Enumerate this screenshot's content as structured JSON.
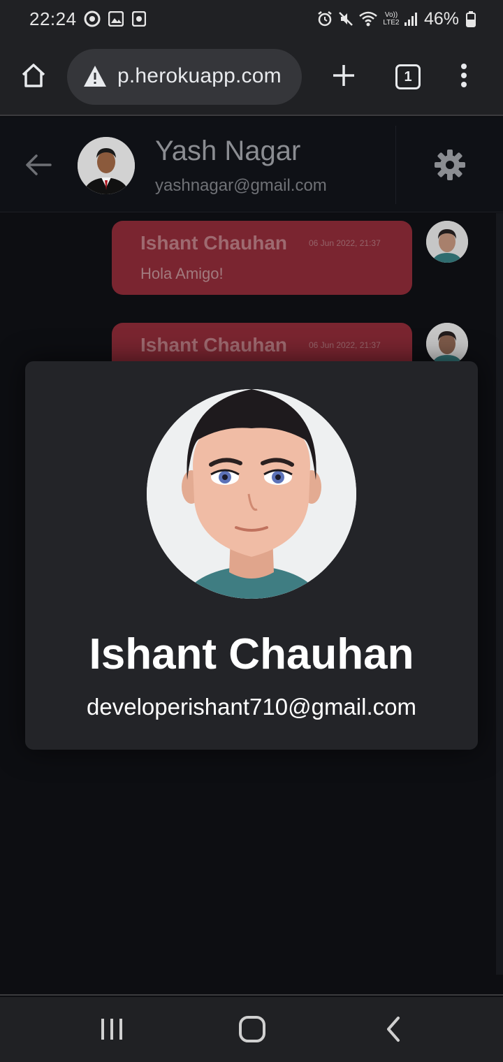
{
  "status_bar": {
    "time": "22:24",
    "battery": "46%",
    "icons": [
      "ring-icon",
      "gallery-icon",
      "media-icon",
      "alarm-icon",
      "mute-icon",
      "wifi-icon",
      "volte-icon",
      "signal-icon",
      "battery-icon"
    ],
    "network_label_top": "Vo))",
    "network_label_bottom": "LTE2"
  },
  "browser": {
    "url": "p.herokuapp.com",
    "tab_count": "1",
    "icons": [
      "home-icon",
      "warning-icon",
      "new-tab-icon",
      "menu-icon"
    ]
  },
  "chat_header": {
    "name": "Yash Nagar",
    "email": "yashnagar@gmail.com",
    "icons": [
      "back-arrow-icon",
      "settings-gear-icon"
    ]
  },
  "messages": [
    {
      "sender": "Ishant Chauhan",
      "time": "06 Jun 2022, 21:37",
      "text": "Hola Amigo!"
    },
    {
      "sender": "Ishant Chauhan",
      "time": "06 Jun 2022, 21:37",
      "text": ""
    }
  ],
  "profile_modal": {
    "name": "Ishant Chauhan",
    "email": "developerishant710@gmail.com"
  },
  "nav_bar": {
    "icons": [
      "recent-apps-icon",
      "home-nav-icon",
      "back-nav-icon"
    ]
  },
  "colors": {
    "bubble": "#7a2530",
    "modal_bg": "#232428",
    "page_bg": "#0d0e12",
    "chrome_bg": "#202124"
  }
}
